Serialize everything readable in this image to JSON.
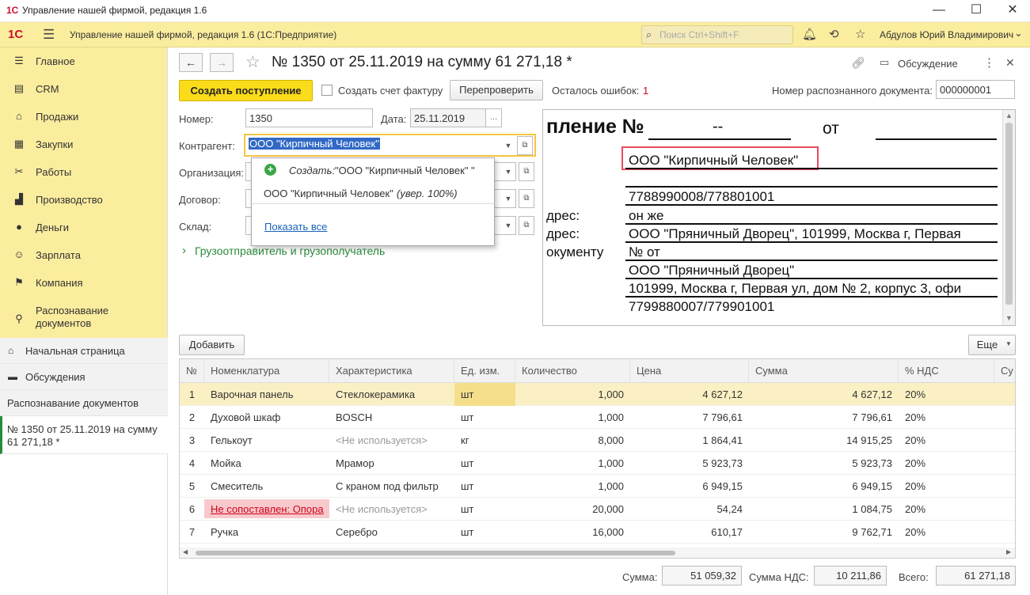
{
  "window": {
    "title": "Управление нашей фирмой, редакция 1.6",
    "logo": "1С"
  },
  "appbar": {
    "logo": "1С",
    "title": "Управление нашей фирмой, редакция 1.6  (1С:Предприятие)",
    "search_placeholder": "Поиск Ctrl+Shift+F",
    "user": "Абдулов Юрий Владимирович"
  },
  "sidebar": {
    "items": [
      {
        "label": "Главное",
        "icon": "menu-icon"
      },
      {
        "label": "CRM",
        "icon": "crm-icon"
      },
      {
        "label": "Продажи",
        "icon": "sales-icon"
      },
      {
        "label": "Закупки",
        "icon": "purchases-icon"
      },
      {
        "label": "Работы",
        "icon": "tools-icon"
      },
      {
        "label": "Производство",
        "icon": "factory-icon"
      },
      {
        "label": "Деньги",
        "icon": "money-icon"
      },
      {
        "label": "Зарплата",
        "icon": "people-icon"
      },
      {
        "label": "Компания",
        "icon": "flag-icon"
      },
      {
        "label": "Распознавание документов",
        "icon": "recognition-icon"
      }
    ],
    "open_windows": [
      {
        "label": "Начальная страница"
      },
      {
        "label": "Обсуждения"
      },
      {
        "label": "Распознавание документов"
      },
      {
        "label": "№ 1350 от 25.11.2019 на сумму 61 271,18 *"
      }
    ]
  },
  "document": {
    "title": "№ 1350 от 25.11.2019 на сумму 61 271,18 *",
    "discussion": "Обсуждение",
    "create_button": "Создать поступление",
    "create_invoice": "Создать счет фактуру",
    "recheck": "Перепроверить",
    "errors_label": "Осталось ошибок:",
    "errors_count": "1",
    "recog_number_label": "Номер распознанного документа:",
    "recog_number": "000000001",
    "number_label": "Номер:",
    "number": "1350",
    "date_label": "Дата:",
    "date": "25.11.2019",
    "counterparty_label": "Контрагент:",
    "counterparty": "ООО \"Кирпичный Человек\"",
    "organization_label": "Организация:",
    "contract_label": "Договор:",
    "warehouse_label": "Склад:",
    "shipper_section": "Грузоотправитель и грузополучатель"
  },
  "popup": {
    "create_prefix": "Создать:",
    "create_value": " \"ООО \"Кирпичный Человек\" \"",
    "option": "ООО \"Кирпичный Человек\"",
    "option_conf": "(увер. 100%)",
    "show_all": "Показать все"
  },
  "scan": {
    "heading": "пление №",
    "dash": "--",
    "ot": "от",
    "company": "ООО \"Кирпичный Человек\"",
    "inn": "7788990008/778801001",
    "addr_label1": "дрес:",
    "addr_val1": "он же",
    "addr_label2": "дрес:",
    "addr_val2": "ООО \"Пряничный Дворец\", 101999, Москва г, Первая",
    "doc_label": "окументу",
    "doc_val": "№  от",
    "consignee": "ООО \"Пряничный Дворец\"",
    "consignee_addr": "101999, Москва г, Первая ул, дом № 2, корпус 3, офи",
    "consignee_inn": "7799880007/779901001"
  },
  "table": {
    "add_button": "Добавить",
    "more_button": "Еще",
    "headers": [
      "№",
      "Номенклатура",
      "Характеристика",
      "Ед. изм.",
      "Количество",
      "Цена",
      "Сумма",
      "% НДС",
      "Су"
    ],
    "rows": [
      {
        "n": "1",
        "name": "Варочная панель",
        "char": "Стеклокерамика",
        "unit": "шт",
        "qty": "1,000",
        "price": "4 627,12",
        "sum": "4 627,12",
        "vat": "20%"
      },
      {
        "n": "2",
        "name": "Духовой шкаф",
        "char": "BOSCH",
        "unit": "шт",
        "qty": "1,000",
        "price": "7 796,61",
        "sum": "7 796,61",
        "vat": "20%"
      },
      {
        "n": "3",
        "name": "Гелькоут",
        "char": "<Не используется>",
        "unit": "кг",
        "qty": "8,000",
        "price": "1 864,41",
        "sum": "14 915,25",
        "vat": "20%"
      },
      {
        "n": "4",
        "name": "Мойка",
        "char": "Мрамор",
        "unit": "шт",
        "qty": "1,000",
        "price": "5 923,73",
        "sum": "5 923,73",
        "vat": "20%"
      },
      {
        "n": "5",
        "name": "Смеситель",
        "char": "С краном под фильтр",
        "unit": "шт",
        "qty": "1,000",
        "price": "6 949,15",
        "sum": "6 949,15",
        "vat": "20%"
      },
      {
        "n": "6",
        "name": "Не сопоставлен: Опора",
        "char": "<Не используется>",
        "unit": "шт",
        "qty": "20,000",
        "price": "54,24",
        "sum": "1 084,75",
        "vat": "20%"
      },
      {
        "n": "7",
        "name": "Ручка",
        "char": "Серебро",
        "unit": "шт",
        "qty": "16,000",
        "price": "610,17",
        "sum": "9 762,71",
        "vat": "20%"
      }
    ]
  },
  "totals": {
    "sum_label": "Сумма:",
    "sum": "51 059,32",
    "vat_label": "Сумма НДС:",
    "vat": "10 211,86",
    "total_label": "Всего:",
    "total": "61 271,18"
  },
  "colors": {
    "accent": "#fbdc1a",
    "sidebar": "#fbed9e",
    "error": "#d0021b",
    "selected_row": "#fbf0c4"
  }
}
